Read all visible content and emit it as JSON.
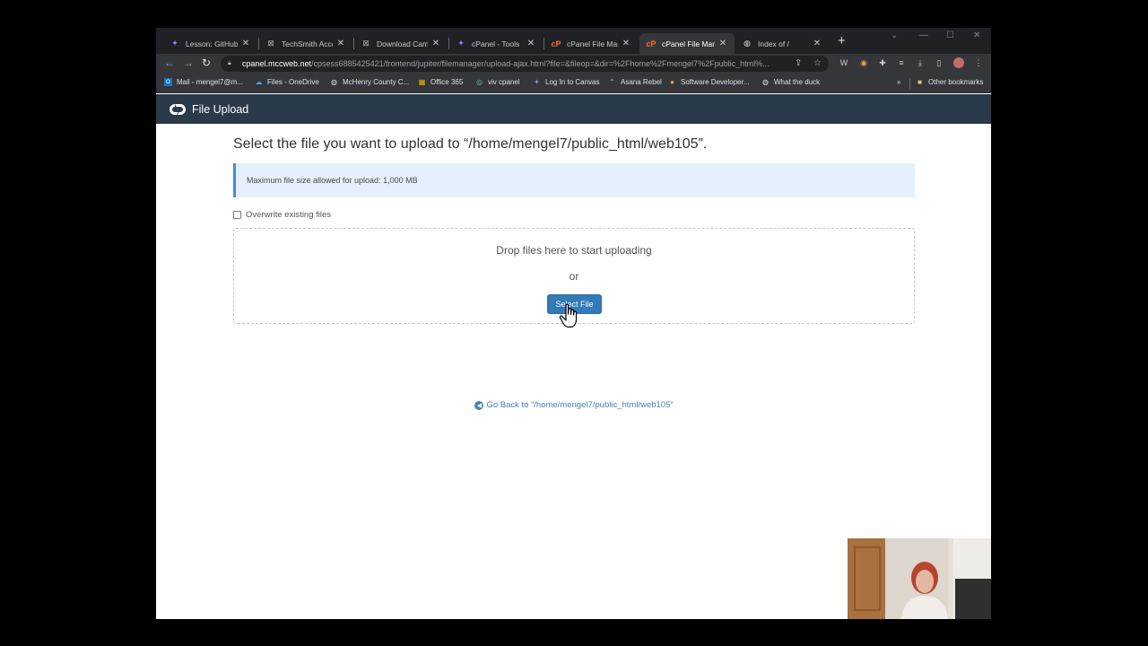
{
  "tabs": [
    {
      "title": "Lesson: GitHub",
      "icon": "github-icon",
      "active": false
    },
    {
      "title": "TechSmith Accou",
      "icon": "techsmith-icon",
      "active": false
    },
    {
      "title": "Download Camta",
      "icon": "techsmith-icon",
      "active": false
    },
    {
      "title": "cPanel - Tools",
      "icon": "cpanel-icon",
      "active": false
    },
    {
      "title": "cPanel File Manag",
      "icon": "cpanel-icon",
      "active": false
    },
    {
      "title": "cPanel File Manag",
      "icon": "cpanel-icon",
      "active": true
    },
    {
      "title": "Index of /",
      "icon": "globe-icon",
      "active": false
    }
  ],
  "address": {
    "host": "cpanel.mccweb.net",
    "path": "/cpsess6885425421/frontend/jupiter/filemanager/upload-ajax.html?file=&fileop=&dir=%2Fhome%2Fmengel7%2Fpublic_html%..."
  },
  "bookmarks": [
    {
      "label": "Mail - mengel7@m...",
      "icon": "outlook-icon"
    },
    {
      "label": "Files - OneDrive",
      "icon": "onedrive-icon"
    },
    {
      "label": "McHenry County C...",
      "icon": "globe-icon"
    },
    {
      "label": "Office 365",
      "icon": "office-icon"
    },
    {
      "label": "viv cpanel",
      "icon": "cpanel-icon"
    },
    {
      "label": "Log In to Canvas",
      "icon": "canvas-icon"
    },
    {
      "label": "Asana Rebel",
      "icon": "asana-icon"
    },
    {
      "label": "Software Developer...",
      "icon": "bookmark-icon"
    },
    {
      "label": "What the duck",
      "icon": "globe-icon"
    }
  ],
  "other_bookmarks": "Other bookmarks",
  "page": {
    "header_title": "File Upload",
    "heading": "Select the file you want to upload to “/home/mengel7/public_html/web105”.",
    "max_size_notice": "Maximum file size allowed for upload: 1,000 MB",
    "overwrite_label": "Overwrite existing files",
    "drop_text": "Drop files here to start uploading",
    "or_text": "or",
    "select_button": "Select File",
    "go_back": "Go Back to “/home/mengel7/public_html/web105”"
  },
  "colors": {
    "header_bg": "#293a4a",
    "primary_button": "#337ab7",
    "alert_bg": "#e4f1fd",
    "link": "#4a7fb5"
  }
}
